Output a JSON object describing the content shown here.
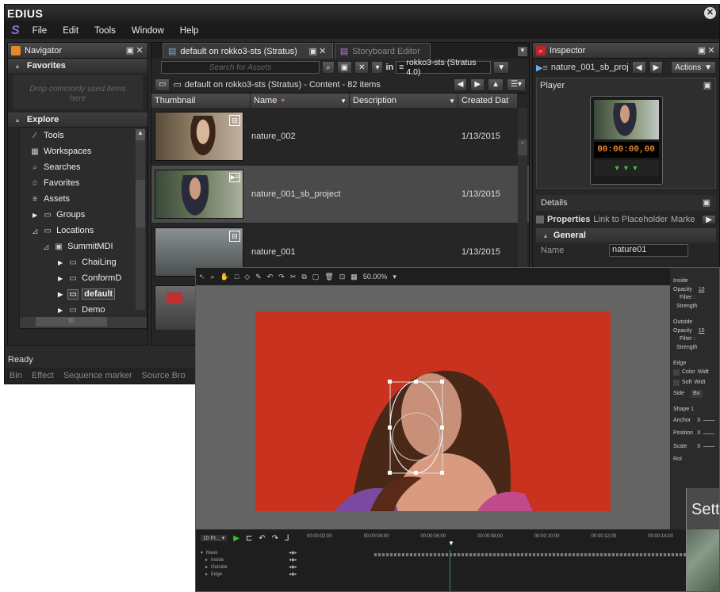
{
  "app": {
    "title": "EDIUS"
  },
  "menu": [
    "File",
    "Edit",
    "Tools",
    "Window",
    "Help"
  ],
  "navigator": {
    "title": "Navigator",
    "favorites_label": "Favorites",
    "drop_hint": "Drop commonly used items here",
    "explore_label": "Explore",
    "items": [
      {
        "label": "Tools",
        "icon": "wand-icon"
      },
      {
        "label": "Workspaces",
        "icon": "workspace-icon"
      },
      {
        "label": "Searches",
        "icon": "search-icon"
      },
      {
        "label": "Favorites",
        "icon": "favorites-icon"
      },
      {
        "label": "Assets",
        "icon": "assets-icon"
      },
      {
        "label": "Groups",
        "icon": "folder-icon"
      },
      {
        "label": "Locations",
        "icon": "folder-icon"
      },
      {
        "label": "SummitMDI",
        "icon": "server-icon"
      },
      {
        "label": "ChaiLing",
        "icon": "folder-icon"
      },
      {
        "label": "ConformD",
        "icon": "folder-icon"
      },
      {
        "label": "default",
        "icon": "folder-icon"
      },
      {
        "label": "Demo",
        "icon": "folder-icon"
      }
    ],
    "scroll_label": "III"
  },
  "content": {
    "tabs": [
      {
        "label": "default on rokko3-sts (Stratus)"
      },
      {
        "label": "Storyboard Editor"
      }
    ],
    "search_placeholder": "Search for Assets",
    "in_label": "in",
    "location": "rokko3-sts (Stratus 4.0)",
    "breadcrumb": "default on rokko3-sts (Stratus)  -  Content  -  82 items",
    "columns": [
      "Thumbnail",
      "Name",
      "Description",
      "Created Dat"
    ],
    "rows": [
      {
        "name": "nature_002",
        "date": "1/13/2015"
      },
      {
        "name": "nature_001_sb_project",
        "date": "1/13/2015"
      },
      {
        "name": "nature_001",
        "date": "1/13/2015"
      }
    ]
  },
  "inspector": {
    "title": "Inspector",
    "asset": "nature_001_sb_proj...",
    "actions_label": "Actions",
    "player_label": "Player",
    "timecode": "00:00:00,00",
    "details_label": "Details",
    "subtabs": [
      "Properties",
      "Link to Placeholder",
      "Marke"
    ],
    "general_label": "General",
    "name_label": "Name",
    "name_value": "nature01"
  },
  "status": {
    "text": "Ready",
    "bottom_tabs": [
      "Bin",
      "Effect",
      "Sequence marker",
      "Source Bro"
    ]
  },
  "overlay": {
    "zoom": "50.00%",
    "inside_label": "Inside",
    "outside_label": "Outside",
    "edge_label": "Edge",
    "shape_label": "Shape 1",
    "opacity_label": "Opacity",
    "opacity_value": "10",
    "filter_label": "Filter",
    "strength_label": "Strength",
    "color_label": "Color",
    "soft_label": "Soft",
    "width_label": "Widt",
    "side_label": "Side",
    "side_value": "Bo",
    "anchor_label": "Anchor",
    "position_label": "Position",
    "scale_label": "Scale",
    "rot_label": "Rot",
    "axis_label": "X",
    "settings_label": "Sett",
    "timeline_ticks": [
      "00:00:02;00",
      "00:00:04;00",
      "00:00:06;00",
      "00:00:08;00",
      "00:00:10;00",
      "00:00:12;00",
      "00:00:14;00"
    ],
    "track_labels": [
      "Mask",
      "Inside",
      "Outside",
      "Edge"
    ],
    "track_prefix": "10 Fr..."
  },
  "colors": {
    "accent_orange": "#e8862a",
    "select_blue": "#3d6fa8",
    "bg_dark": "#2a2a2a"
  }
}
